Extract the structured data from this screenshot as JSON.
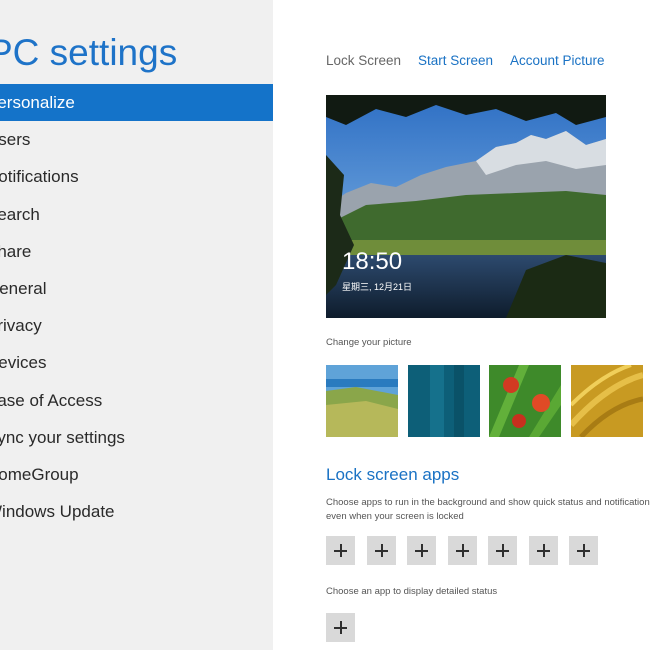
{
  "sidebar": {
    "title": "PC settings",
    "items": [
      {
        "label": "Personalize"
      },
      {
        "label": "Users"
      },
      {
        "label": "Notifications"
      },
      {
        "label": "Search"
      },
      {
        "label": "Share"
      },
      {
        "label": "General"
      },
      {
        "label": "Privacy"
      },
      {
        "label": "Devices"
      },
      {
        "label": "Ease of Access"
      },
      {
        "label": "Sync your settings"
      },
      {
        "label": "HomeGroup"
      },
      {
        "label": "Windows Update"
      }
    ],
    "active_index": 0
  },
  "tabs": [
    {
      "label": "Lock Screen",
      "selected": true
    },
    {
      "label": "Start Screen",
      "selected": false
    },
    {
      "label": "Account Picture",
      "selected": false
    }
  ],
  "lock_preview": {
    "time": "18:50",
    "date": "星期三, 12月21日"
  },
  "change_picture": {
    "label": "Change your picture",
    "thumbnails": [
      "grassy-hill-seaside",
      "teal-abstract",
      "red-flowers-green-leaves",
      "golden-grass"
    ]
  },
  "lock_screen_apps": {
    "heading": "Lock screen apps",
    "description": "Choose apps to run in the background and show quick status and notifications, even when your screen is locked",
    "slot_count": 7,
    "detailed_label": "Choose an app to display detailed status",
    "detailed_slot_count": 1
  },
  "colors": {
    "accent": "#1473c9",
    "link": "#1a72c4",
    "sidebar_bg": "#f0f0f0"
  }
}
